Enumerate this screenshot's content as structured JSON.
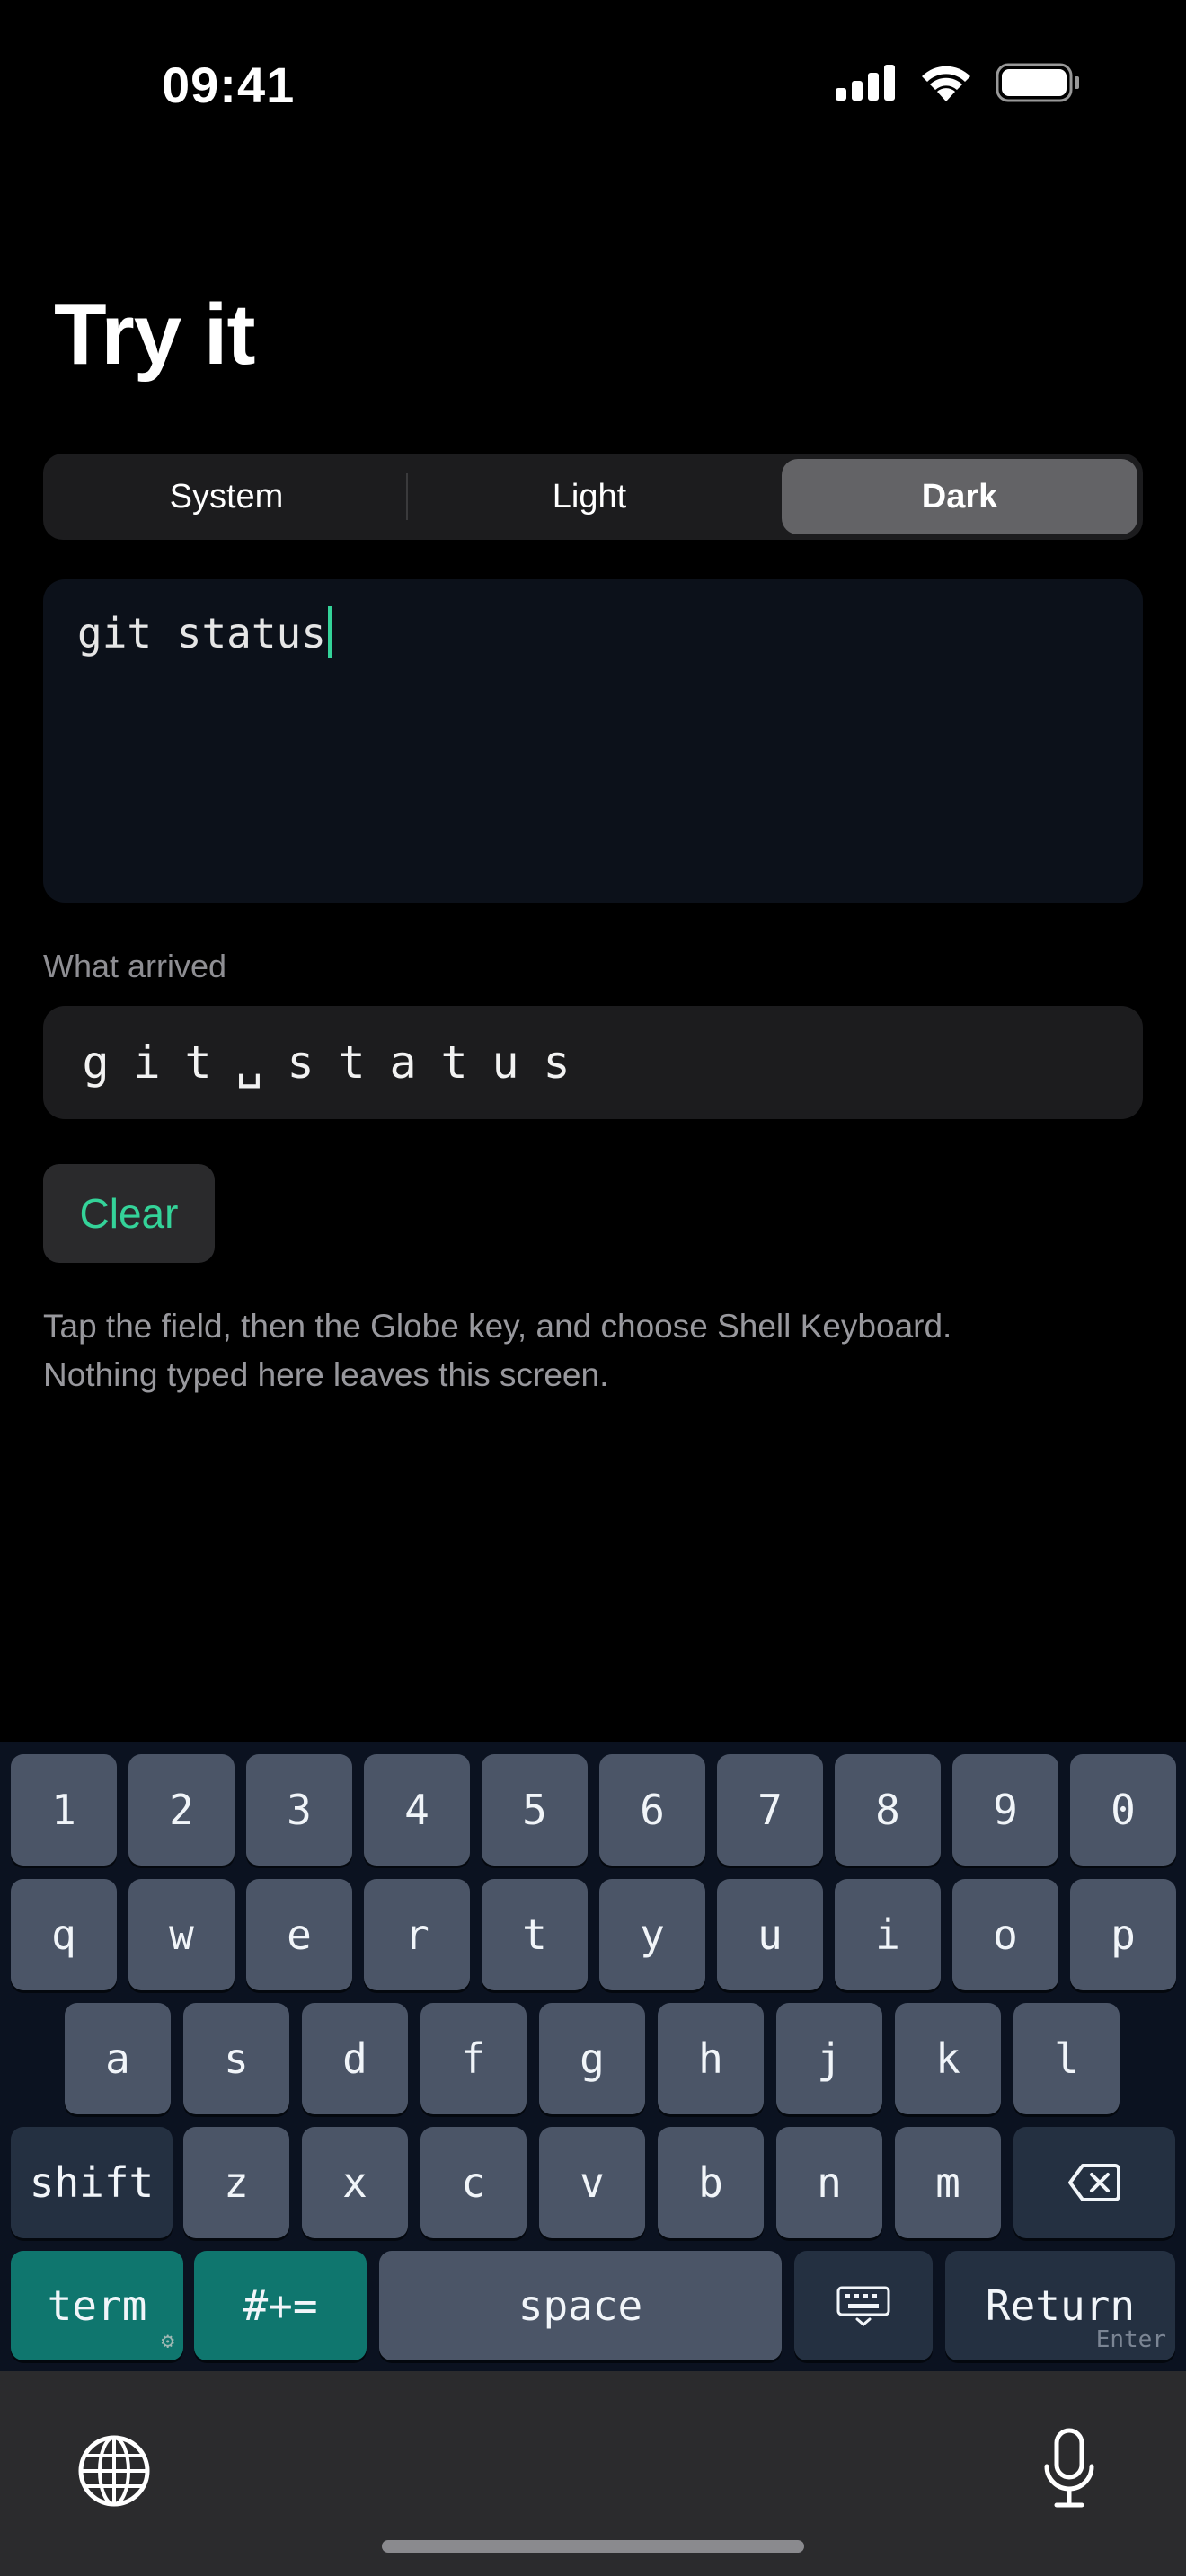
{
  "status_bar": {
    "time": "09:41",
    "icons": [
      "cellular-signal-icon",
      "wifi-icon",
      "battery-icon"
    ]
  },
  "page": {
    "title": "Try it"
  },
  "appearance": {
    "options": [
      "System",
      "Light",
      "Dark"
    ],
    "selected": "Dark"
  },
  "input": {
    "value": "git status"
  },
  "arrived": {
    "label": "What arrived",
    "chars": [
      "g",
      "i",
      "t",
      "␣",
      "s",
      "t",
      "a",
      "t",
      "u",
      "s"
    ]
  },
  "clear_button": {
    "label": "Clear"
  },
  "help": {
    "line1": "Tap the field, then the Globe key, and choose Shell Keyboard.",
    "line2": "Nothing typed here leaves this screen."
  },
  "keyboard": {
    "number_row": [
      "1",
      "2",
      "3",
      "4",
      "5",
      "6",
      "7",
      "8",
      "9",
      "0"
    ],
    "row1": [
      "q",
      "w",
      "e",
      "r",
      "t",
      "y",
      "u",
      "i",
      "o",
      "p"
    ],
    "row2": [
      "a",
      "s",
      "d",
      "f",
      "g",
      "h",
      "j",
      "k",
      "l"
    ],
    "row3": [
      "z",
      "x",
      "c",
      "v",
      "b",
      "n",
      "m"
    ],
    "shift_label": "shift",
    "term_label": "term",
    "symbols_label": "#+=",
    "space_label": "space",
    "return_label": "Return",
    "enter_label": "Enter",
    "colors": {
      "key": "#4b5567",
      "key_dark": "#243041",
      "key_accent": "#0f766e",
      "background": "#0b1220"
    }
  },
  "accent_color": "#34d399"
}
